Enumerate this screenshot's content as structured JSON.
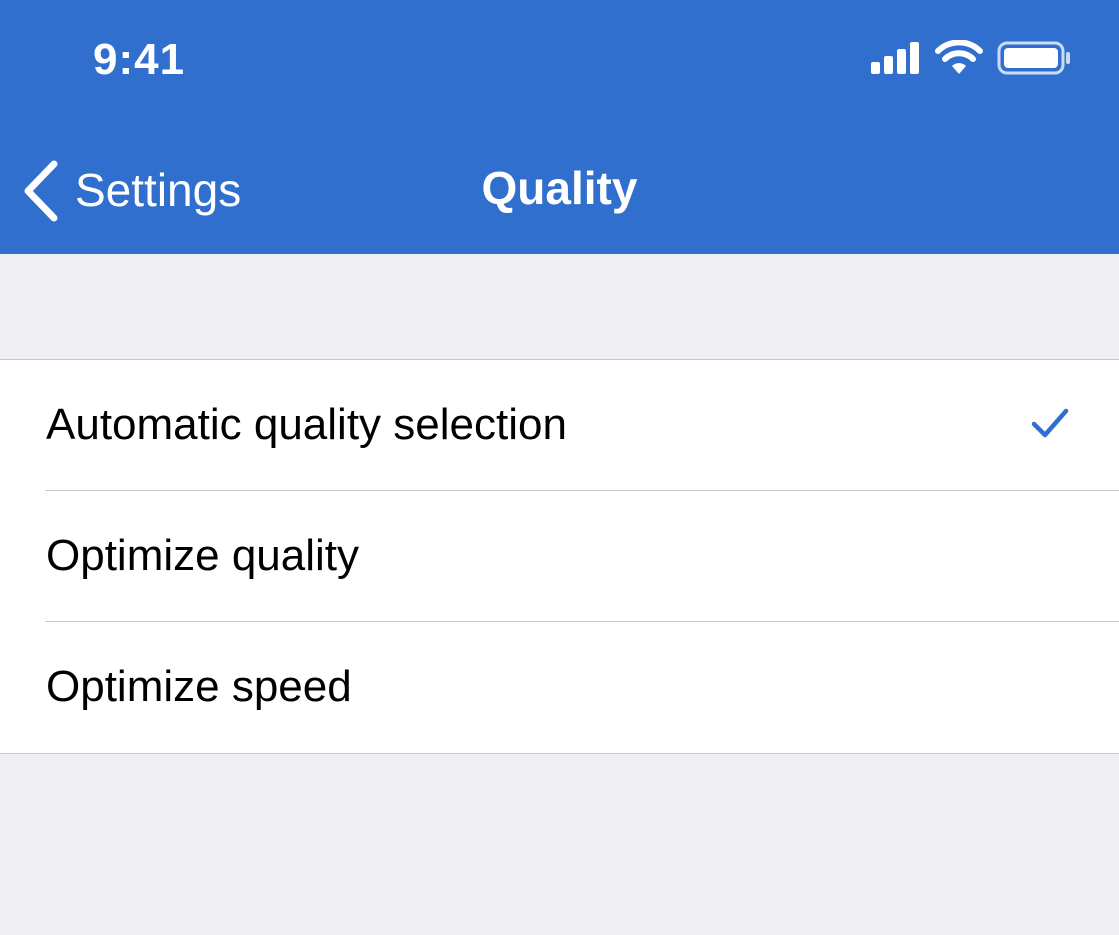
{
  "status_bar": {
    "time": "9:41",
    "icons": [
      "cellular-signal-icon",
      "wifi-icon",
      "battery-icon"
    ]
  },
  "nav": {
    "back_label": "Settings",
    "title": "Quality"
  },
  "options": [
    {
      "label": "Automatic quality selection",
      "selected": true
    },
    {
      "label": "Optimize quality",
      "selected": false
    },
    {
      "label": "Optimize speed",
      "selected": false
    }
  ],
  "colors": {
    "header": "#316fcf",
    "background": "#efeff4",
    "checkmark": "#316fcf"
  }
}
